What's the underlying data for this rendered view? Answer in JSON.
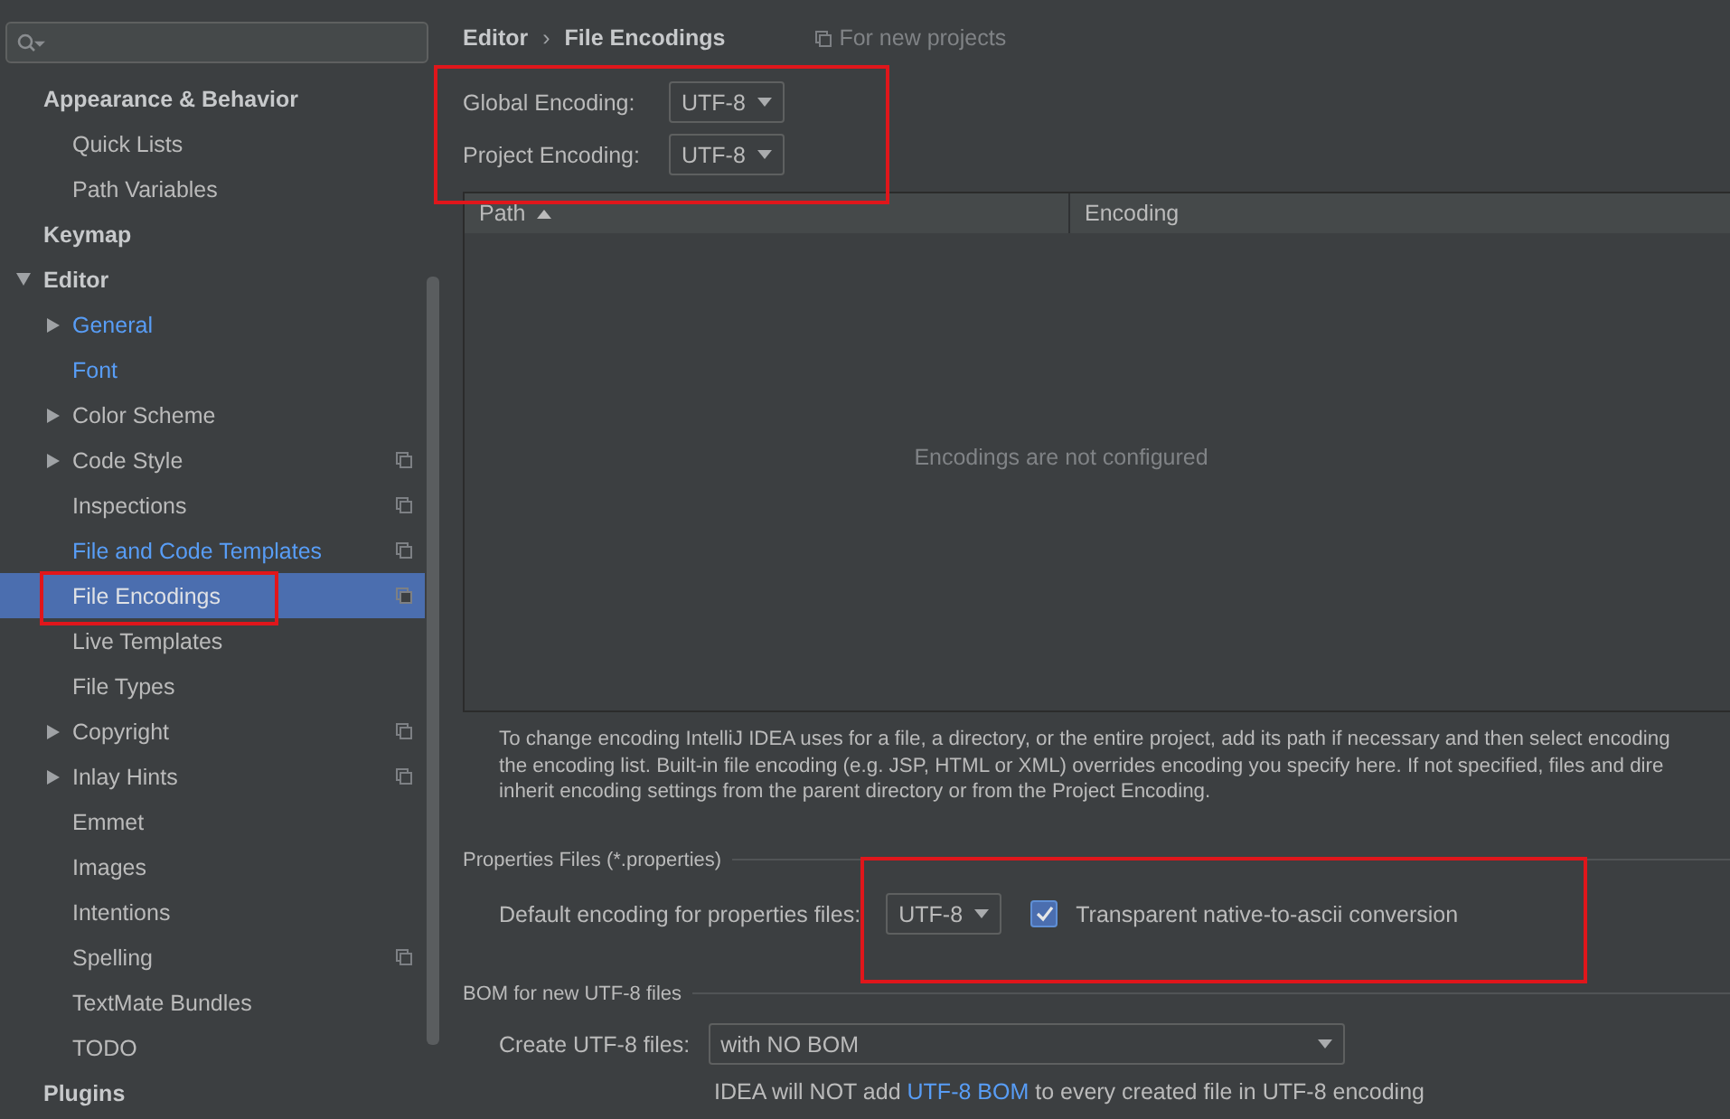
{
  "sidebar": {
    "items": [
      {
        "label": "Appearance & Behavior",
        "children": [
          {
            "label": "Quick Lists",
            "selected": false,
            "modified": false,
            "project_level": false
          },
          {
            "label": "Path Variables",
            "selected": false,
            "modified": false,
            "project_level": false
          }
        ]
      },
      {
        "label": "Keymap"
      },
      {
        "label": "Editor",
        "expanded": true,
        "children": [
          {
            "label": "General",
            "selected": false,
            "modified": true,
            "project_level": false,
            "expanded": false
          },
          {
            "label": "Font",
            "selected": false,
            "modified": true,
            "project_level": false
          },
          {
            "label": "Color Scheme",
            "selected": false,
            "modified": false,
            "project_level": false,
            "expanded": false
          },
          {
            "label": "Code Style",
            "selected": false,
            "modified": false,
            "project_level": true,
            "expanded": false
          },
          {
            "label": "Inspections",
            "selected": false,
            "modified": false,
            "project_level": true
          },
          {
            "label": "File and Code Templates",
            "selected": false,
            "modified": true,
            "project_level": true
          },
          {
            "label": "File Encodings",
            "selected": true,
            "modified": false,
            "project_level": true
          },
          {
            "label": "Live Templates",
            "selected": false,
            "modified": false,
            "project_level": false
          },
          {
            "label": "File Types",
            "selected": false,
            "modified": false,
            "project_level": false
          },
          {
            "label": "Copyright",
            "selected": false,
            "modified": false,
            "project_level": true,
            "expanded": false
          },
          {
            "label": "Inlay Hints",
            "selected": false,
            "modified": false,
            "project_level": true,
            "expanded": false
          },
          {
            "label": "Emmet",
            "selected": false,
            "modified": false,
            "project_level": false
          },
          {
            "label": "Images",
            "selected": false,
            "modified": false,
            "project_level": false
          },
          {
            "label": "Intentions",
            "selected": false,
            "modified": false,
            "project_level": false
          },
          {
            "label": "Spelling",
            "selected": false,
            "modified": false,
            "project_level": true
          },
          {
            "label": "TextMate Bundles",
            "selected": false,
            "modified": false,
            "project_level": false
          },
          {
            "label": "TODO",
            "selected": false,
            "modified": false,
            "project_level": false
          }
        ]
      },
      {
        "label": "Plugins"
      }
    ]
  },
  "breadcrumb": {
    "parent": "Editor",
    "separator": "›",
    "current": "File Encodings",
    "scope_note": "For new projects"
  },
  "global_encoding": {
    "label": "Global Encoding:",
    "value": "UTF-8"
  },
  "project_encoding": {
    "label": "Project Encoding:",
    "value": "UTF-8"
  },
  "table": {
    "columns": [
      {
        "label": "Path",
        "sorted": true
      },
      {
        "label": "Encoding",
        "sorted": false
      }
    ],
    "empty_text": "Encodings are not configured"
  },
  "description_lines": [
    "To change encoding IntelliJ IDEA uses for a file, a directory, or the entire project, add its path if necessary and then select encoding",
    "the encoding list. Built-in file encoding (e.g. JSP, HTML or XML) overrides encoding you specify here. If not specified, files and dire",
    "inherit encoding settings from the parent directory or from the Project Encoding."
  ],
  "properties_files": {
    "title": "Properties Files (*.properties)",
    "label": "Default encoding for properties files:",
    "value": "UTF-8",
    "checkbox": {
      "label": "Transparent native-to-ascii conversion",
      "checked": true
    }
  },
  "bom": {
    "title": "BOM for new UTF-8 files",
    "label": "Create UTF-8 files:",
    "value": "with NO BOM",
    "note_before": "IDEA will NOT add",
    "note_link": "UTF-8 BOM",
    "note_after": "to every created file in UTF-8 encoding"
  }
}
